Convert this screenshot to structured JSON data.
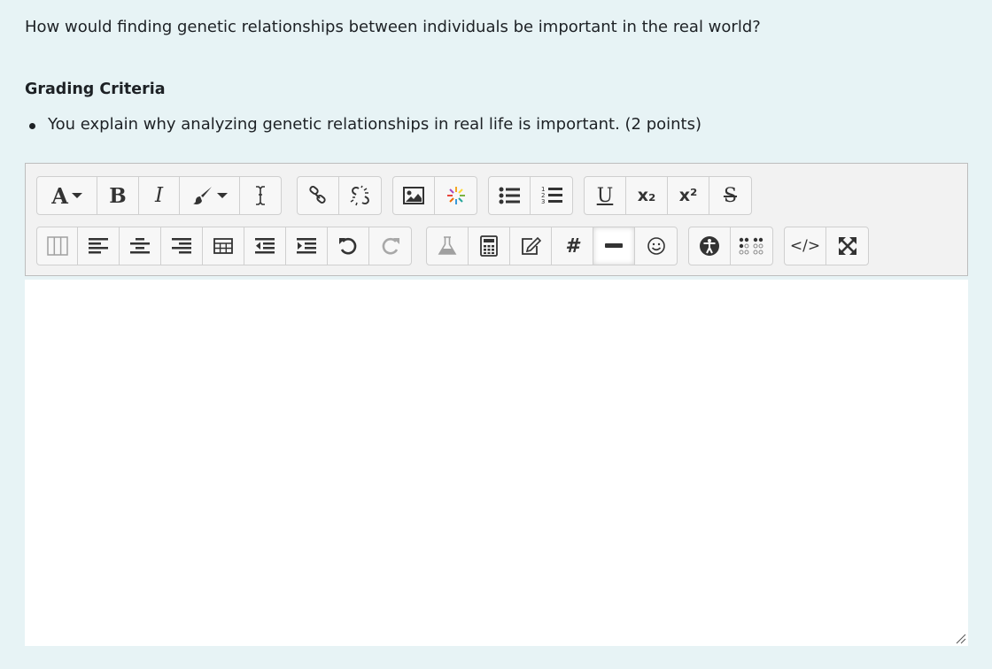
{
  "question": {
    "text": "How would finding genetic relationships between individuals be important in the real world?"
  },
  "grading": {
    "title": "Grading Criteria",
    "criteria": [
      "You explain why analyzing genetic relationships in real life is important. (2 points)"
    ]
  },
  "toolbar": {
    "font_label": "A",
    "bold_label": "B",
    "italic_label": "I",
    "underline_label": "U",
    "subscript_label": "x₂",
    "superscript_label": "x²",
    "strikethrough_label": "S",
    "equation_label": "#",
    "html_label": "</>",
    "row1_icons": [
      "font-style-icon",
      "bold-icon",
      "italic-icon",
      "text-color-icon",
      "clear-formatting-icon",
      "link-icon",
      "unlink-icon",
      "image-icon",
      "media-icon",
      "bullet-list-icon",
      "numbered-list-icon",
      "underline-icon",
      "subscript-icon",
      "superscript-icon",
      "strikethrough-icon"
    ],
    "row2_icons": [
      "columns-icon",
      "align-left-icon",
      "align-center-icon",
      "align-right-icon",
      "table-icon",
      "outdent-icon",
      "indent-icon",
      "undo-icon",
      "redo-icon",
      "flask-icon",
      "calculator-icon",
      "edit-icon",
      "equation-icon",
      "horizontal-rule-icon",
      "emoji-icon",
      "accessibility-icon",
      "braille-icon",
      "html-icon",
      "fullscreen-icon"
    ],
    "colors": {
      "toolbar_bg": "#f2f2f2",
      "page_bg": "#e7f3f5",
      "disabled_icon": "#a8a8a8"
    }
  }
}
